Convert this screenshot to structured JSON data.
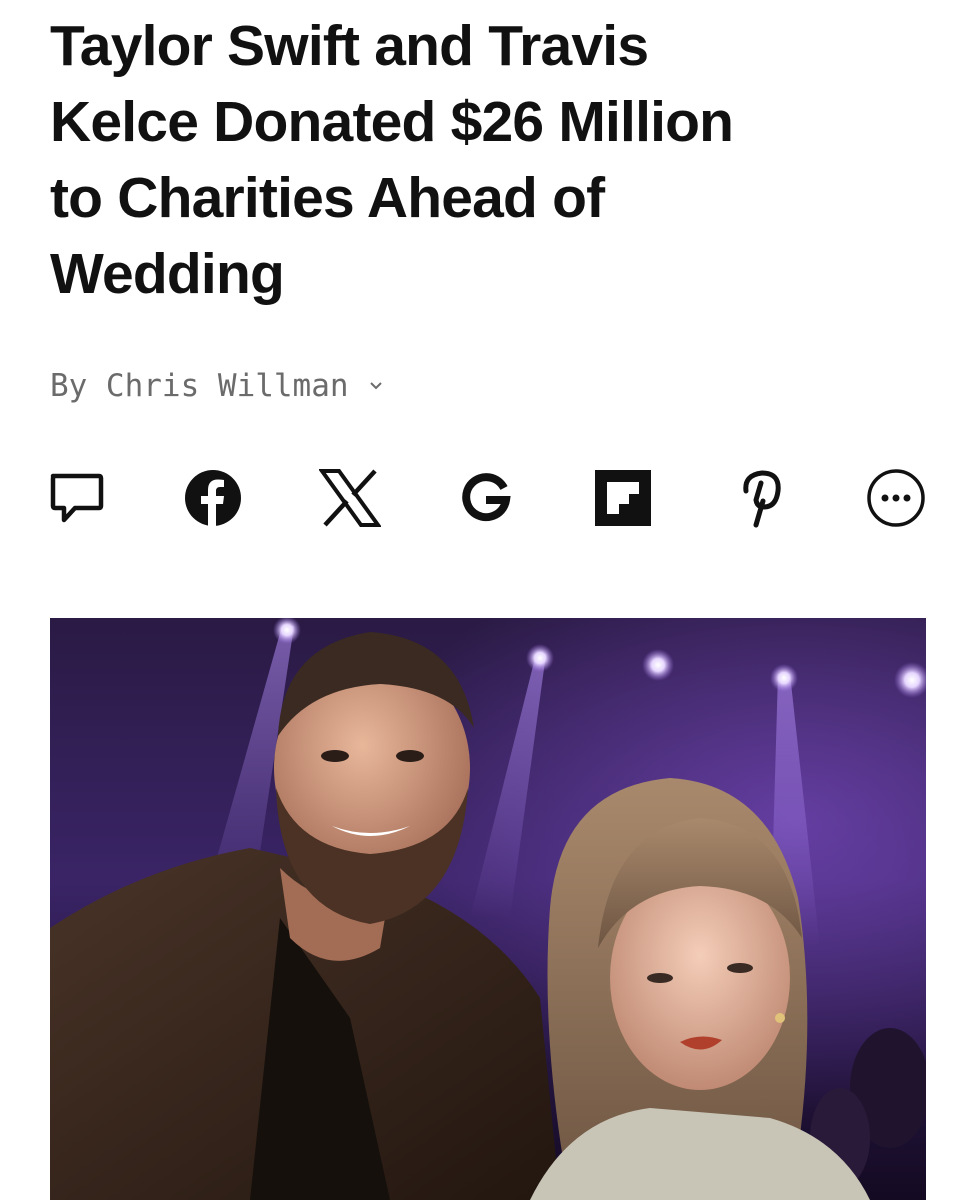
{
  "article": {
    "headline_lines": [
      "Taylor Swift and Travis",
      "Kelce Donated $26 Million",
      "to Charities Ahead of",
      "Wedding"
    ],
    "byline_prefix": "By",
    "author": "Chris Willman"
  },
  "share_icons": [
    "comment-icon",
    "facebook-icon",
    "x-icon",
    "google-icon",
    "flipboard-icon",
    "pinterest-icon",
    "more-icon"
  ],
  "hero_image": {
    "subject": "photo of a bearded man in a brown leather jacket and a woman with bangs and red lipstick under purple stage lights"
  },
  "colors": {
    "text": "#111111",
    "byline": "#6b6b6b",
    "stage_purple": "#6a3fb0",
    "stage_dark": "#1a0f2a"
  }
}
